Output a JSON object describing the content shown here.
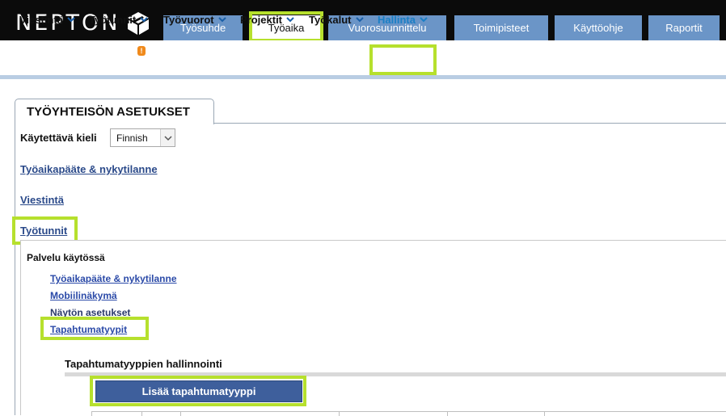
{
  "brand": {
    "name": "NEPTON",
    "logo_icon": "nepton-cube-icon"
  },
  "main_tabs": [
    {
      "label": "Työsuhde",
      "active": false
    },
    {
      "label": "Työaika",
      "active": true
    },
    {
      "label": "Vuorosuunnittelu",
      "active": false
    },
    {
      "label": "Toimipisteet",
      "active": false
    },
    {
      "label": "Käyttöohje",
      "active": false
    },
    {
      "label": "Raportit",
      "active": false
    }
  ],
  "sub_nav": [
    {
      "label": "Viestintä"
    },
    {
      "label": "Työtunnit",
      "badge": "!"
    },
    {
      "label": "Työvuorot"
    },
    {
      "label": "Projektit"
    },
    {
      "label": "Työkalut"
    },
    {
      "label": "Hallinta",
      "active": true
    }
  ],
  "panel": {
    "tab_title": "TYÖYHTEISÖN ASETUKSET",
    "language_label": "Käytettävä kieli",
    "language_value": "Finnish",
    "sections": [
      {
        "label": "Työaikapääte & nykytilanne"
      },
      {
        "label": "Viestintä"
      },
      {
        "label": "Työtunnit"
      }
    ],
    "service_title": "Palvelu käytössä",
    "service_items": [
      {
        "label": "Työaikapääte & nykytilanne"
      },
      {
        "label": "Mobiilinäkymä"
      },
      {
        "label": "Näytön asetukset"
      },
      {
        "label": "Tapahtumatyypit"
      }
    ],
    "management_title": "Tapahtumatyyppien hallinnointi",
    "add_button": "Lisää tapahtumatyyppi"
  },
  "colors": {
    "tab": "#6b95c7",
    "highlight": "#b6e02d",
    "button": "#3e5f9c",
    "link": "#2b4a8a",
    "badge": "#f08a1c"
  }
}
